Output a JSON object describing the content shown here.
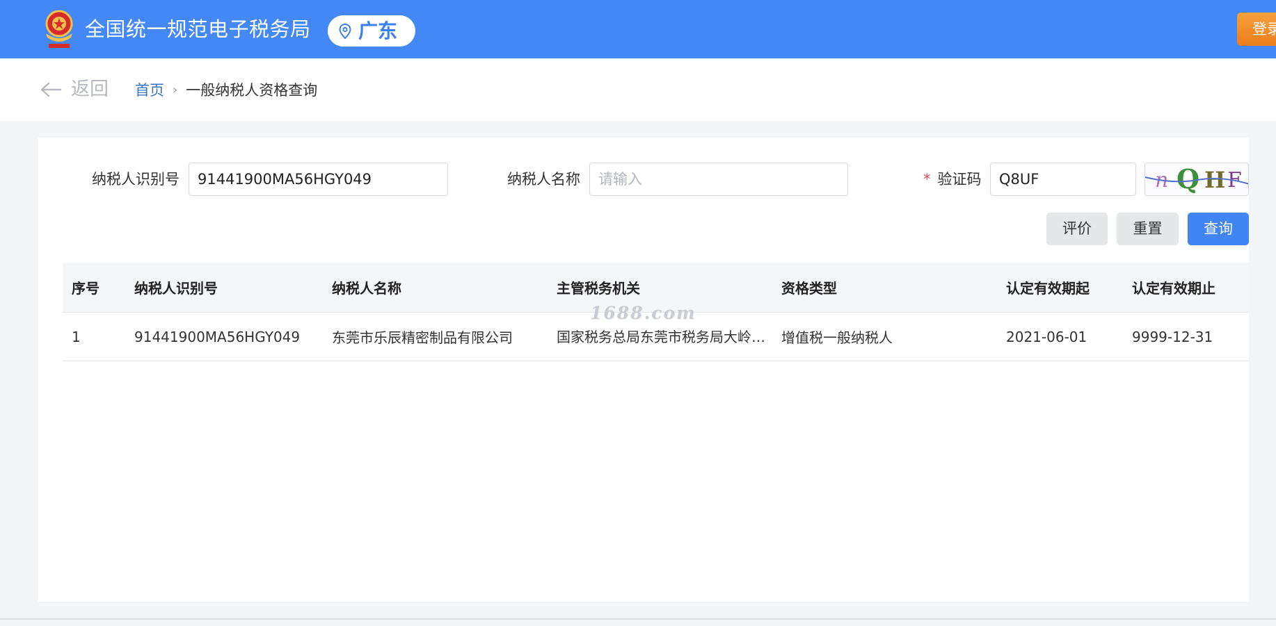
{
  "header": {
    "site_title": "全国统一规范电子税务局",
    "region": "广东",
    "login_label": "登录"
  },
  "nav": {
    "back_label": "返回",
    "breadcrumb_home": "首页",
    "breadcrumb_separator": "›",
    "breadcrumb_current": "一般纳税人资格查询"
  },
  "form": {
    "taxpayer_id_label": "纳税人识别号",
    "taxpayer_id_value": "91441900MA56HGY049",
    "taxpayer_name_label": "纳税人名称",
    "taxpayer_name_placeholder": "请输入",
    "captcha_required_mark": "*",
    "captcha_label": "验证码",
    "captcha_value": "Q8UF",
    "captcha_image_text": "nQHF"
  },
  "buttons": {
    "evaluate": "评价",
    "reset": "重置",
    "query": "查询"
  },
  "table": {
    "headers": [
      "序号",
      "纳税人识别号",
      "纳税人名称",
      "主管税务机关",
      "资格类型",
      "认定有效期起",
      "认定有效期止"
    ],
    "rows": [
      [
        "1",
        "91441900MA56HGY049",
        "东莞市乐辰精密制品有限公司",
        "国家税务总局东莞市税务局大岭山税务分局",
        "增值税一般纳税人",
        "2021-06-01",
        "9999-12-31"
      ]
    ]
  },
  "watermark": "1688.com",
  "colors": {
    "header_bg": "#4388f4",
    "primary_button": "#4185f3",
    "login_button": "#f0902a",
    "breadcrumb_link": "#3b73c3"
  },
  "icons": {
    "emblem": "national-emblem-icon",
    "region": "location-pin-icon",
    "back": "arrow-left-icon"
  }
}
